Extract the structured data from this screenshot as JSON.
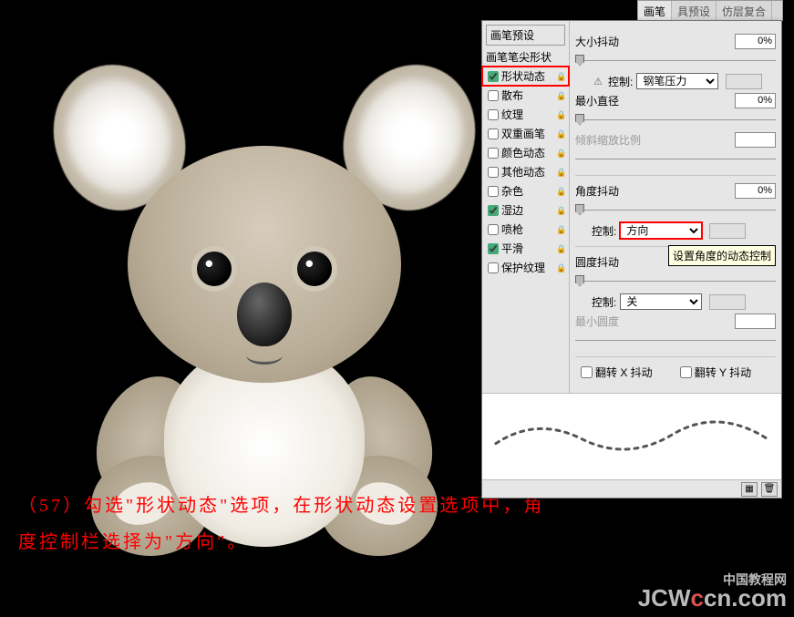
{
  "instruction": "（57）勾选\"形状动态\"选项，在形状动态设置选项中，角度控制栏选择为\"方向\"。",
  "watermark": {
    "cn": "中国教程网",
    "domain_a": "JCW",
    "domain_b": "cn.com",
    "dot": "c"
  },
  "panel_tabs": {
    "brush": "画笔",
    "preset": "具预设",
    "clone": "仿层复合"
  },
  "preset": {
    "header": "画笔预设",
    "shape_tip": "画笔笔尖形状",
    "items": [
      {
        "label": "形状动态",
        "checked": true,
        "lock": true,
        "hl": true
      },
      {
        "label": "散布",
        "checked": false,
        "lock": true
      },
      {
        "label": "纹理",
        "checked": false,
        "lock": true
      },
      {
        "label": "双重画笔",
        "checked": false,
        "lock": true
      },
      {
        "label": "颜色动态",
        "checked": false,
        "lock": true
      },
      {
        "label": "其他动态",
        "checked": false,
        "lock": true
      },
      {
        "label": "杂色",
        "checked": false,
        "lock": true
      },
      {
        "label": "湿边",
        "checked": true,
        "lock": true
      },
      {
        "label": "喷枪",
        "checked": false,
        "lock": true
      },
      {
        "label": "平滑",
        "checked": true,
        "lock": true
      },
      {
        "label": "保护纹理",
        "checked": false,
        "lock": true
      }
    ]
  },
  "settings": {
    "size_jitter": {
      "label": "大小抖动",
      "value": "0%"
    },
    "control1": {
      "label": "控制:",
      "value": "钢笔压力"
    },
    "min_diameter": {
      "label": "最小直径",
      "value": "0%"
    },
    "tilt_scale": {
      "label": "倾斜缩放比例"
    },
    "angle_jitter": {
      "label": "角度抖动",
      "value": "0%"
    },
    "control2": {
      "label": "控制:",
      "value": "方向"
    },
    "roundness_jitter": {
      "label": "圆度抖动"
    },
    "tooltip": "设置角度的动态控制",
    "control3": {
      "label": "控制:",
      "value": "关"
    },
    "min_round": {
      "label": "最小圆度"
    },
    "flip_x": "翻转 X 抖动",
    "flip_y": "翻转 Y 抖动"
  }
}
